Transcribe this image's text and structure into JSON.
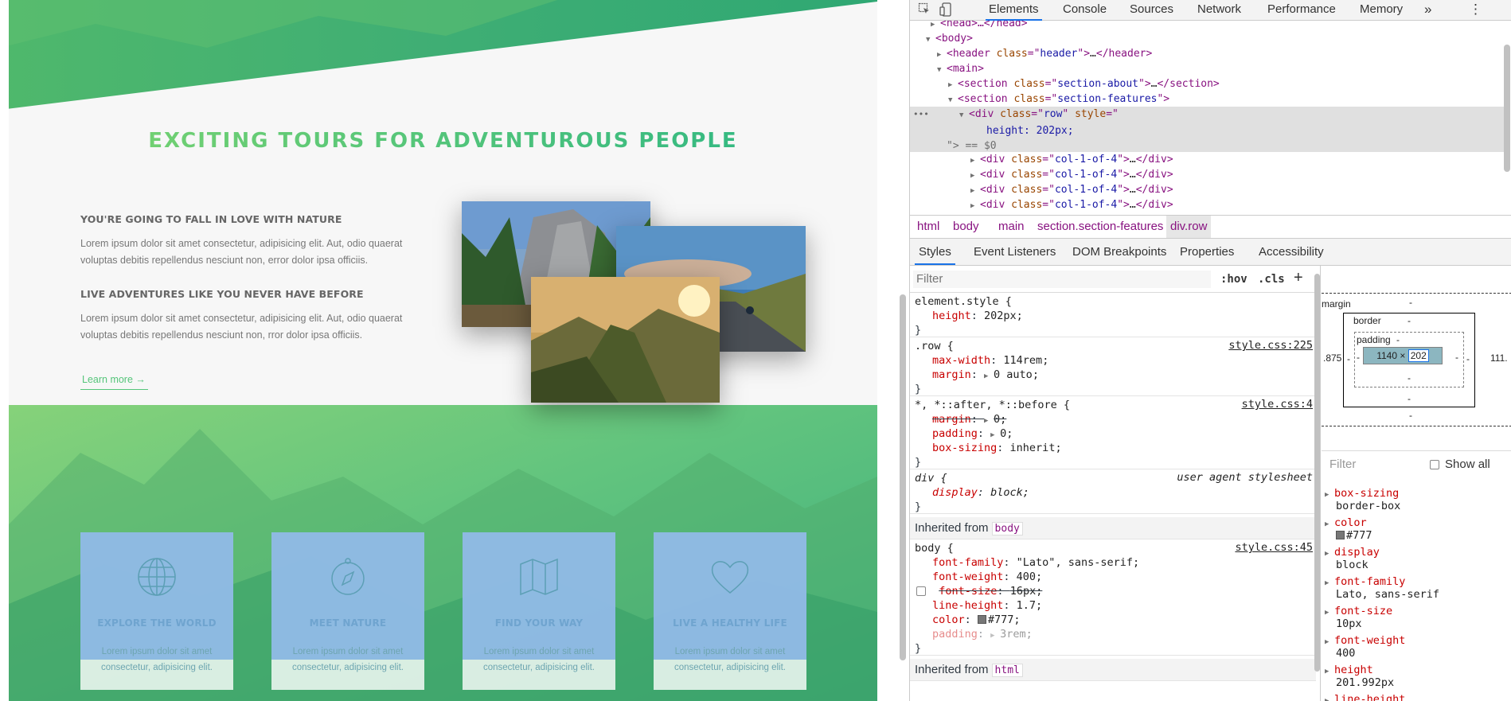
{
  "website": {
    "about_heading": "EXCITING TOURS FOR ADVENTUROUS PEOPLE",
    "h3_1": "YOU'RE GOING TO FALL IN LOVE WITH NATURE",
    "p1_line1": "Lorem ipsum dolor sit amet consectetur, adipisicing elit. Aut, odio quaerat",
    "p1_line2": "voluptas debitis repellendus nesciunt non, error dolor ipsa officiis.",
    "h3_2": "LIVE ADVENTURES LIKE YOU NEVER HAVE BEFORE",
    "p2_line1": "Lorem ipsum dolor sit amet consectetur, adipisicing elit. Aut, odio quaerat",
    "p2_line2": "voluptas debitis repellendus nesciunt non, rror dolor ipsa officiis.",
    "learn_more": "Learn more →",
    "features": [
      {
        "title": "EXPLORE THE WORLD",
        "icon": "globe-icon",
        "text1": "Lorem ipsum dolor sit amet",
        "text2": "consectetur, adipisicing elit."
      },
      {
        "title": "MEET NATURE",
        "icon": "compass-icon",
        "text1": "Lorem ipsum dolor sit amet",
        "text2": "consectetur, adipisicing elit."
      },
      {
        "title": "FIND YOUR WAY",
        "icon": "map-icon",
        "text1": "Lorem ipsum dolor sit amet",
        "text2": "consectetur, adipisicing elit."
      },
      {
        "title": "LIVE A HEALTHY LIFE",
        "icon": "heart-icon",
        "text1": "Lorem ipsum dolor sit amet",
        "text2": "consectetur, adipisicing elit."
      }
    ],
    "accent_green_light": "#7ed56f",
    "accent_green_dark": "#28b485"
  },
  "devtools": {
    "tabs": [
      "Elements",
      "Console",
      "Sources",
      "Network",
      "Performance",
      "Memory"
    ],
    "active_tab": "Elements",
    "more_tabs": "»",
    "more_menu": "⋮",
    "dom": {
      "head": "<head>…</head>",
      "body_open": "<body>",
      "header_tag": "header",
      "header_class": "header",
      "main_open": "<main>",
      "section_about_class": "section-about",
      "section_features_class": "section-features",
      "row_class": "row",
      "row_style": "height: 202px;",
      "row_eq": "\"> == $0",
      "col_class": "col-1-of-4",
      "ellipsis": "…"
    },
    "breadcrumbs": [
      "html",
      "body",
      "main",
      "section.section-features",
      "div.row"
    ],
    "subtabs": [
      "Styles",
      "Event Listeners",
      "DOM Breakpoints",
      "Properties",
      "Accessibility"
    ],
    "styles": {
      "filter_placeholder": "Filter",
      "hov": ":hov",
      "cls": ".cls",
      "plus": "+",
      "element_style_selector": "element.style {",
      "element_style_prop": "height",
      "element_style_val": "202px;",
      "row_selector": ".row {",
      "row_source": "style.css:225",
      "row_prop1": "max-width",
      "row_val1": "114rem;",
      "row_prop2": "margin",
      "row_val2": "0 auto;",
      "universal_selector": "*, *::after, *::before {",
      "universal_source": "style.css:4",
      "u_prop1": "margin",
      "u_val1": "0;",
      "u_prop2": "padding",
      "u_val2": "0;",
      "u_prop3": "box-sizing",
      "u_val3": "inherit;",
      "div_selector": "div {",
      "div_source": "user agent stylesheet",
      "div_prop": "display",
      "div_val": "block;",
      "inherited_from_label": "Inherited from",
      "inherited_body": "body",
      "body_selector": "body {",
      "body_source": "style.css:45",
      "b_prop1": "font-family",
      "b_val1": "\"Lato\", sans-serif;",
      "b_prop2": "font-weight",
      "b_val2": "400;",
      "b_prop3": "font-size",
      "b_val3": "16px;",
      "b_prop4": "line-height",
      "b_val4": "1.7;",
      "b_prop5": "color",
      "b_val5": "#777;",
      "b_prop6": "padding",
      "b_val6": "3rem;",
      "inherited_html": "html",
      "close_brace": "}"
    },
    "box_model": {
      "margin_label": "margin",
      "border_label": "border",
      "padding_label": "padding",
      "dash": "-",
      "left_margin": ".875",
      "right_margin": "111.",
      "content_width": "1140",
      "times": "×",
      "content_height": "202"
    },
    "computed": {
      "filter_placeholder": "Filter",
      "show_all": "Show all",
      "props": [
        {
          "name": "box-sizing",
          "value": "border-box"
        },
        {
          "name": "color",
          "value": "#777"
        },
        {
          "name": "display",
          "value": "block"
        },
        {
          "name": "font-family",
          "value": "Lato, sans-serif"
        },
        {
          "name": "font-size",
          "value": "10px"
        },
        {
          "name": "font-weight",
          "value": "400"
        },
        {
          "name": "height",
          "value": "201.992px"
        },
        {
          "name": "line-height",
          "value": ""
        }
      ]
    }
  }
}
